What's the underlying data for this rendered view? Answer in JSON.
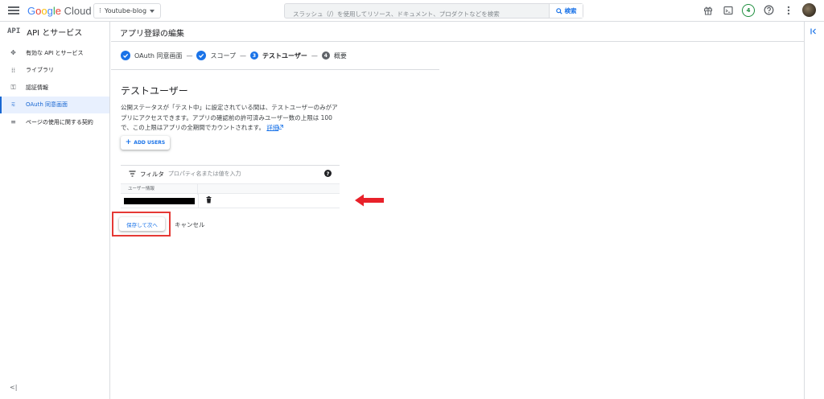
{
  "header": {
    "logo_google": "Google",
    "logo_cloud": "Cloud",
    "project_name": "Youtube-blog",
    "search_placeholder": "スラッシュ（/）を使用してリソース、ドキュメント、プロダクトなどを検索",
    "search_button": "検索",
    "notification_count": "4",
    "icons": [
      "gift-icon",
      "terminal-icon",
      "help-icon",
      "more-vert-icon",
      "avatar"
    ]
  },
  "sidebar": {
    "header_icon": "API",
    "header_title": "API とサービス",
    "items": [
      {
        "label": "有効な API とサービス",
        "icon": "✥",
        "active": false
      },
      {
        "label": "ライブラリ",
        "icon": "⁞⁞",
        "active": false
      },
      {
        "label": "認証情報",
        "icon": "⚿",
        "active": false
      },
      {
        "label": "OAuth 同意画面",
        "icon": "⩳",
        "active": true
      },
      {
        "label": "ページの使用に関する契約",
        "icon": "≡",
        "active": false
      }
    ],
    "collapse_icon": "<|"
  },
  "main": {
    "page_title": "アプリ登録の編集",
    "stepper": {
      "step1": "OAuth 同意画面",
      "step2": "スコープ",
      "step3_num": "3",
      "step3": "テストユーザー",
      "step4_num": "4",
      "step4": "概要",
      "sep": "—"
    },
    "section_title": "テストユーザー",
    "description": "公開ステータスが「テスト中」に設定されている間は、テストユーザーのみがアプリにアクセスできます。アプリの確認前の許可済みユーザー数の上限は 100 で、この上限はアプリの全期間でカウントされます。",
    "details_link": "詳細",
    "add_users_button": "ADD USERS",
    "filter": {
      "label": "フィルタ",
      "placeholder": "プロパティ名または値を入力"
    },
    "table": {
      "column_header": "ユーザー情報"
    },
    "save_button": "保存して次へ",
    "cancel_button": "キャンセル"
  },
  "colors": {
    "accent": "#1a73e8",
    "annotation_red": "#e53935",
    "active_bg": "#e8f0fe"
  }
}
